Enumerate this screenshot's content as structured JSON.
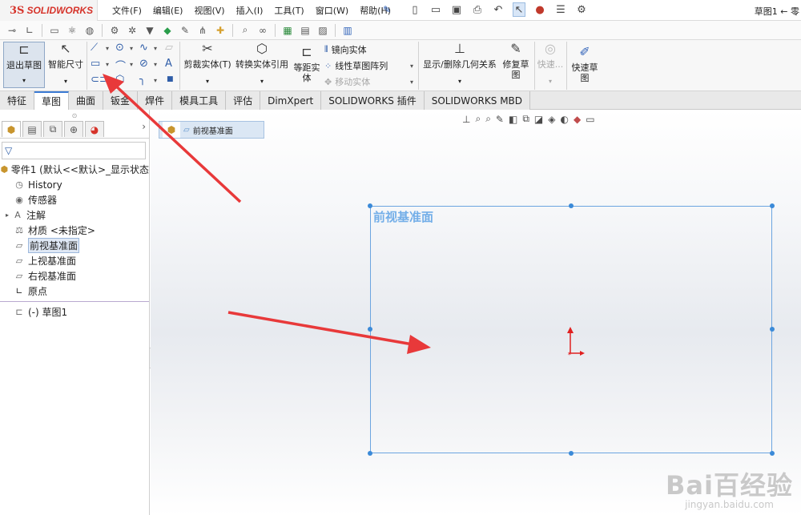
{
  "app": {
    "logo_prefix": "3S",
    "logo_name": "SOLIDWORKS",
    "document_title": "草图1 ← 零"
  },
  "menu": [
    "文件(F)",
    "编辑(E)",
    "视图(V)",
    "插入(I)",
    "工具(T)",
    "窗口(W)",
    "帮助(H)"
  ],
  "command_manager": {
    "exit_sketch": "退出草图",
    "smart_dimension": "智能尺寸",
    "trim": "剪裁实体(T)",
    "convert": "转换实体引用",
    "offset_line1": "等距实",
    "offset_line2": "体",
    "mirror": "镜向实体",
    "linear_pattern": "线性草图阵列",
    "move": "移动实体",
    "display_relations": "显示/删除几何关系",
    "repair_line1": "修复草",
    "repair_line2": "图",
    "quick_snaps": "快速...",
    "rapid_line1": "快速草",
    "rapid_line2": "图"
  },
  "tabs": [
    {
      "label": "特征",
      "active": false
    },
    {
      "label": "草图",
      "active": true
    },
    {
      "label": "曲面",
      "active": false
    },
    {
      "label": "钣金",
      "active": false
    },
    {
      "label": "焊件",
      "active": false
    },
    {
      "label": "模具工具",
      "active": false
    },
    {
      "label": "评估",
      "active": false
    },
    {
      "label": "DimXpert",
      "active": false
    },
    {
      "label": "SOLIDWORKS 插件",
      "active": false
    },
    {
      "label": "SOLIDWORKS MBD",
      "active": false
    }
  ],
  "tree": {
    "root": "零件1 (默认<<默认>_显示状态",
    "items": [
      {
        "label": "History",
        "icon": "history-icon"
      },
      {
        "label": "传感器",
        "icon": "sensor-icon"
      },
      {
        "label": "注解",
        "icon": "annotation-icon",
        "expandable": true
      },
      {
        "label": "材质 <未指定>",
        "icon": "material-icon"
      },
      {
        "label": "前视基准面",
        "icon": "plane-icon",
        "selected": true
      },
      {
        "label": "上视基准面",
        "icon": "plane-icon"
      },
      {
        "label": "右视基准面",
        "icon": "plane-icon"
      },
      {
        "label": "原点",
        "icon": "origin-icon"
      }
    ],
    "sketch_item": "(-) 草图1"
  },
  "breadcrumb": {
    "label": "前视基准面"
  },
  "plane_label": "前视基准面",
  "watermark": {
    "big": "Bai百经验",
    "small": "jingyan.baidu.com"
  },
  "colors": {
    "accent": "#3b7bd4",
    "plane": "#6ca5e0",
    "arrow": "#e8393a",
    "logo": "#d6332a"
  }
}
